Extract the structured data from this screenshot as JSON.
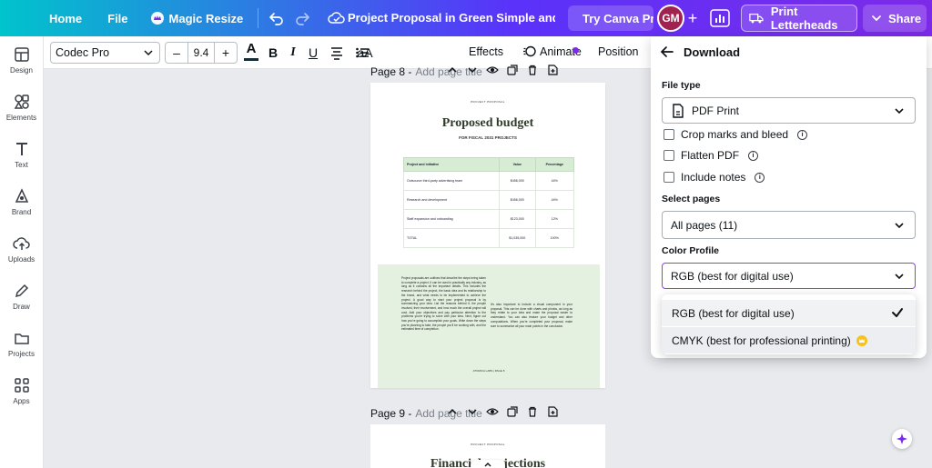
{
  "topbar": {
    "home": "Home",
    "file": "File",
    "magic_resize": "Magic Resize",
    "doc_title": "Project Proposal in Green Simple and Minimal Style",
    "try_canva": "Try Canva Pro",
    "avatar_initials": "GM",
    "print": "Print Letterheads",
    "share": "Share"
  },
  "rail": {
    "items": [
      {
        "label": "Design",
        "icon": "layout-icon"
      },
      {
        "label": "Elements",
        "icon": "shapes-icon"
      },
      {
        "label": "Text",
        "icon": "text-icon"
      },
      {
        "label": "Brand",
        "icon": "brand-icon"
      },
      {
        "label": "Uploads",
        "icon": "cloud-upload-icon"
      },
      {
        "label": "Draw",
        "icon": "pen-icon"
      },
      {
        "label": "Projects",
        "icon": "folder-icon"
      },
      {
        "label": "Apps",
        "icon": "apps-grid-icon"
      }
    ]
  },
  "toolbar": {
    "font": "Codec Pro",
    "minus": "–",
    "font_size": "9.4",
    "plus": "+",
    "text_color": "#172b33",
    "bold": "B",
    "italic": "I",
    "underline": "U",
    "case": "aA",
    "effects": "Effects",
    "animate": "Animate",
    "position": "Position"
  },
  "canvas": {
    "page8_label": "Page 8 -",
    "page8_placeholder": "Add page title",
    "page9_label": "Page 9 -",
    "page9_placeholder": "Add page title",
    "page8": {
      "small_head": "PROJECT PROPOSAL",
      "title": "Proposed budget",
      "subtitle": "FOR FISCAL 2031 PROJECTS",
      "table": {
        "headers": [
          "Project and initiative",
          "Value",
          "Percentage"
        ],
        "rows": [
          [
            "Outsource third-party advertising team",
            "$456,000",
            "44%"
          ],
          [
            "Research and development",
            "$456,000",
            "44%"
          ],
          [
            "Staff expansion and onboarding",
            "$123,000",
            "12%"
          ],
          [
            "TOTAL",
            "$1,035,000",
            "100%"
          ]
        ]
      },
      "col1_text": "Project proposals are outlines that describe the steps being taken to complete a project. It can be used in practically any industry, as long as it contains all the important details. This includes the research behind the project, the basic idea and its relationship to the brand, and what needs to be implemented to achieve the project. A good way to start your project proposal is by summarizing your idea. List the reasons behind it, the people involved, their involvement, and how much the overall project will cost. Add your objectives and pay particular attention to the problems you're trying to solve with your idea. Next, figure out how you're going to accomplish your goals. Write down the steps you're planning to take, the people you'll be working with, and the estimated time of completion.",
      "col2_text": "It's also important to include a visual component in your proposal. This can be done with charts and photos, as long as they relate to your idea and make the proposal easier to understand. You can also feature your budget and other computations. When you're completed your proposal, make sure to summarize all your main points in the conclusion.",
      "footer": "ATOMICA LABS | PAGE 8"
    },
    "page9": {
      "small_head": "PROJECT PROPOSAL",
      "title": "Financial projections"
    }
  },
  "download": {
    "title": "Download",
    "file_type_label": "File type",
    "file_type_value": "PDF Print",
    "crop_marks": "Crop marks and bleed",
    "flatten_pdf": "Flatten PDF",
    "include_notes": "Include notes",
    "select_pages_label": "Select pages",
    "select_pages_value": "All pages (11)",
    "color_profile_label": "Color Profile",
    "color_profile_value": "RGB (best for digital use)",
    "options": [
      {
        "label": "RGB (best for digital use)",
        "selected": true
      },
      {
        "label": "CMYK (best for professional printing)",
        "selected": false
      }
    ]
  }
}
